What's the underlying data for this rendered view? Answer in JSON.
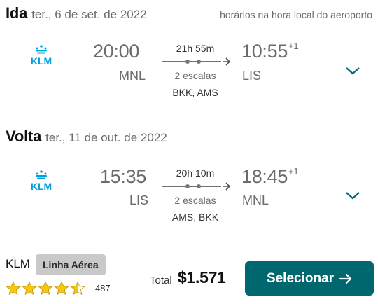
{
  "outbound": {
    "direction": "Ida",
    "date": "ter., 6 de set. de 2022",
    "depart_time": "20:00",
    "arrive_time": "10:55",
    "day_offset": "+1",
    "from": "MNL",
    "to": "LIS",
    "duration": "21h 55m",
    "stops": "2 escalas",
    "via": "BKK, AMS"
  },
  "return": {
    "direction": "Volta",
    "date": "ter., 11 de out. de 2022",
    "depart_time": "15:35",
    "arrive_time": "18:45",
    "day_offset": "+1",
    "from": "LIS",
    "to": "MNL",
    "duration": "20h 10m",
    "stops": "2 escalas",
    "via": "AMS, BKK"
  },
  "timezone_note": "horários na hora local do aeroporto",
  "airline": {
    "name": "KLM",
    "logo_text": "KLM",
    "badge": "Linha Aérea",
    "rating_stars": 4.5,
    "review_count": "487"
  },
  "price": {
    "label": "Total",
    "amount": "$1.571"
  },
  "cta": {
    "label": "Selecionar"
  },
  "colors": {
    "brand_teal": "#00676e",
    "klm_blue": "#00a1de",
    "star": "#f5c518"
  }
}
